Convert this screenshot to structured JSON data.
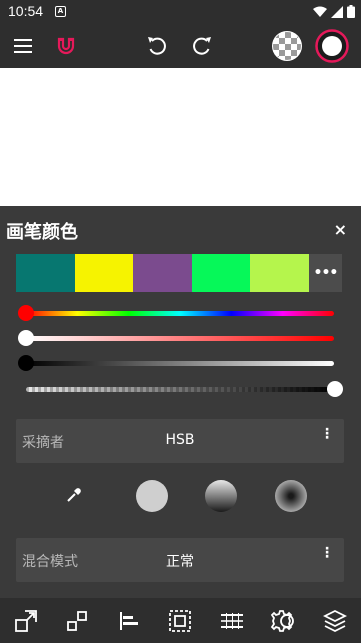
{
  "status_bar": {
    "time": "10:54",
    "notification_letter": "A"
  },
  "toolbar": {
    "menu_icon": "hamburger-menu-icon",
    "magnet_icon": "magnet-icon",
    "magnet_color": "#e5195a",
    "undo_icon": "undo-icon",
    "redo_icon": "redo-icon",
    "pattern_icon": "checker-pattern-icon",
    "color_icon": "current-color-icon",
    "current_color": "#ffffff",
    "ring_color": "#e5195a"
  },
  "panel": {
    "title": "画笔颜色",
    "close_label": "×",
    "swatches": [
      "#077770",
      "#f6f300",
      "#7b4b8e",
      "#06f859",
      "#b5f54c"
    ],
    "more_label": "•••",
    "sliders": {
      "hue": {
        "value": 0
      },
      "saturation": {
        "value": 0
      },
      "brightness": {
        "value": 0
      },
      "opacity": {
        "value": 1
      }
    },
    "picker": {
      "label": "采摘者",
      "value": "HSB",
      "menu": "⋮"
    },
    "blend": {
      "label": "混合模式",
      "value": "正常",
      "menu": "⋮"
    }
  },
  "bottom_bar": {
    "icons": [
      "resize-icon",
      "transform-icon",
      "align-left-icon",
      "select-crop-icon",
      "grid-icon",
      "gear-icon",
      "layers-icon"
    ]
  }
}
